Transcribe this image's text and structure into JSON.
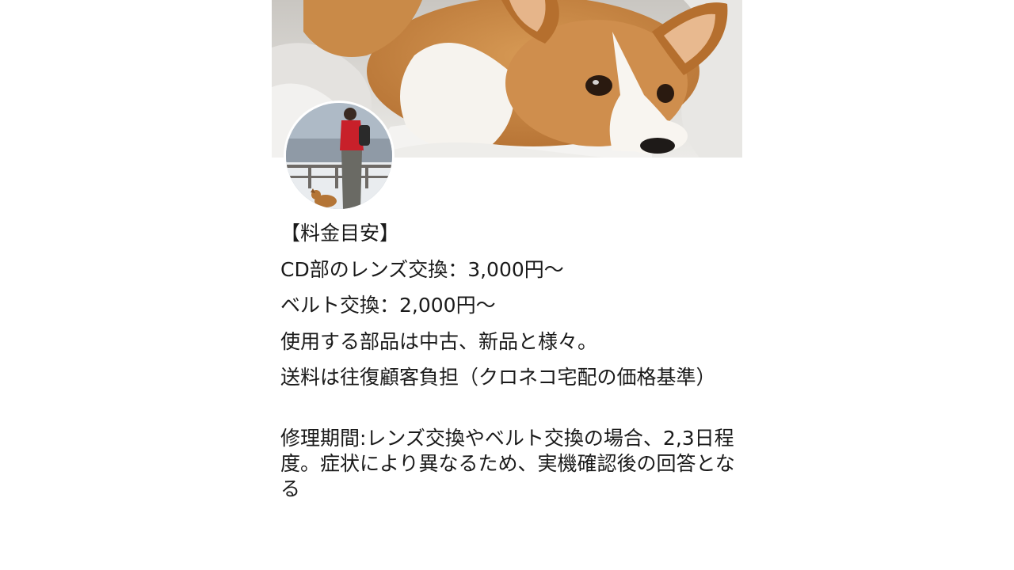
{
  "profile": {
    "cover_alt": "corgi-cover-photo",
    "avatar_alt": "profile-avatar-person-with-dog"
  },
  "description": {
    "lines": [
      "【料金目安】",
      "CD部のレンズ交換：3,000円〜",
      "ベルト交換：2,000円〜",
      "使用する部品は中古、新品と様々。",
      "送料は往復顧客負担（クロネコ宅配の価格基準）"
    ],
    "repair_period": "修理期間:レンズ交換やベルト交換の場合、2,3日程度。症状により異なるため、実機確認後の回答となる"
  }
}
